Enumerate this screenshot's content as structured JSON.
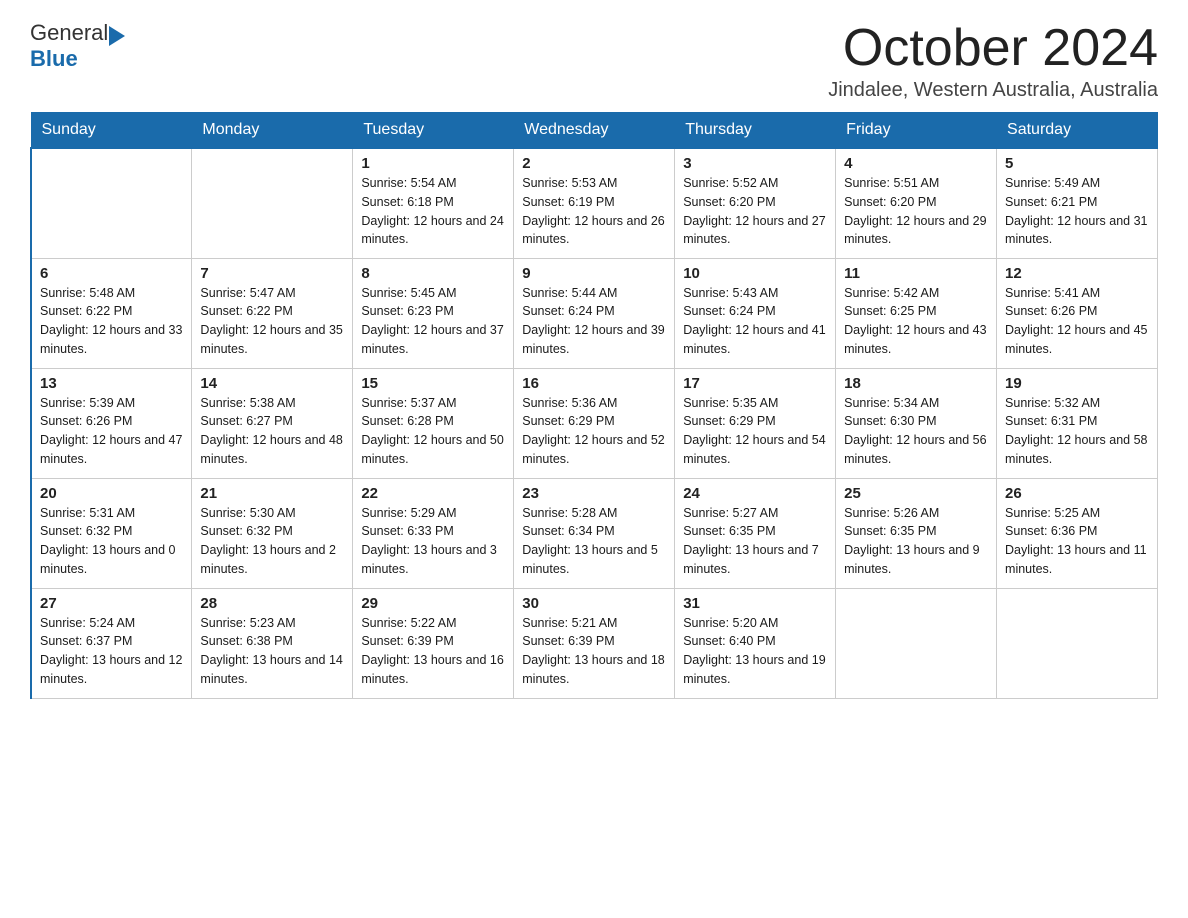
{
  "header": {
    "logo_line1": "General",
    "logo_line2": "Blue",
    "main_title": "October 2024",
    "subtitle": "Jindalee, Western Australia, Australia"
  },
  "weekdays": [
    "Sunday",
    "Monday",
    "Tuesday",
    "Wednesday",
    "Thursday",
    "Friday",
    "Saturday"
  ],
  "weeks": [
    [
      {
        "day": "",
        "sunrise": "",
        "sunset": "",
        "daylight": ""
      },
      {
        "day": "",
        "sunrise": "",
        "sunset": "",
        "daylight": ""
      },
      {
        "day": "1",
        "sunrise": "Sunrise: 5:54 AM",
        "sunset": "Sunset: 6:18 PM",
        "daylight": "Daylight: 12 hours and 24 minutes."
      },
      {
        "day": "2",
        "sunrise": "Sunrise: 5:53 AM",
        "sunset": "Sunset: 6:19 PM",
        "daylight": "Daylight: 12 hours and 26 minutes."
      },
      {
        "day": "3",
        "sunrise": "Sunrise: 5:52 AM",
        "sunset": "Sunset: 6:20 PM",
        "daylight": "Daylight: 12 hours and 27 minutes."
      },
      {
        "day": "4",
        "sunrise": "Sunrise: 5:51 AM",
        "sunset": "Sunset: 6:20 PM",
        "daylight": "Daylight: 12 hours and 29 minutes."
      },
      {
        "day": "5",
        "sunrise": "Sunrise: 5:49 AM",
        "sunset": "Sunset: 6:21 PM",
        "daylight": "Daylight: 12 hours and 31 minutes."
      }
    ],
    [
      {
        "day": "6",
        "sunrise": "Sunrise: 5:48 AM",
        "sunset": "Sunset: 6:22 PM",
        "daylight": "Daylight: 12 hours and 33 minutes."
      },
      {
        "day": "7",
        "sunrise": "Sunrise: 5:47 AM",
        "sunset": "Sunset: 6:22 PM",
        "daylight": "Daylight: 12 hours and 35 minutes."
      },
      {
        "day": "8",
        "sunrise": "Sunrise: 5:45 AM",
        "sunset": "Sunset: 6:23 PM",
        "daylight": "Daylight: 12 hours and 37 minutes."
      },
      {
        "day": "9",
        "sunrise": "Sunrise: 5:44 AM",
        "sunset": "Sunset: 6:24 PM",
        "daylight": "Daylight: 12 hours and 39 minutes."
      },
      {
        "day": "10",
        "sunrise": "Sunrise: 5:43 AM",
        "sunset": "Sunset: 6:24 PM",
        "daylight": "Daylight: 12 hours and 41 minutes."
      },
      {
        "day": "11",
        "sunrise": "Sunrise: 5:42 AM",
        "sunset": "Sunset: 6:25 PM",
        "daylight": "Daylight: 12 hours and 43 minutes."
      },
      {
        "day": "12",
        "sunrise": "Sunrise: 5:41 AM",
        "sunset": "Sunset: 6:26 PM",
        "daylight": "Daylight: 12 hours and 45 minutes."
      }
    ],
    [
      {
        "day": "13",
        "sunrise": "Sunrise: 5:39 AM",
        "sunset": "Sunset: 6:26 PM",
        "daylight": "Daylight: 12 hours and 47 minutes."
      },
      {
        "day": "14",
        "sunrise": "Sunrise: 5:38 AM",
        "sunset": "Sunset: 6:27 PM",
        "daylight": "Daylight: 12 hours and 48 minutes."
      },
      {
        "day": "15",
        "sunrise": "Sunrise: 5:37 AM",
        "sunset": "Sunset: 6:28 PM",
        "daylight": "Daylight: 12 hours and 50 minutes."
      },
      {
        "day": "16",
        "sunrise": "Sunrise: 5:36 AM",
        "sunset": "Sunset: 6:29 PM",
        "daylight": "Daylight: 12 hours and 52 minutes."
      },
      {
        "day": "17",
        "sunrise": "Sunrise: 5:35 AM",
        "sunset": "Sunset: 6:29 PM",
        "daylight": "Daylight: 12 hours and 54 minutes."
      },
      {
        "day": "18",
        "sunrise": "Sunrise: 5:34 AM",
        "sunset": "Sunset: 6:30 PM",
        "daylight": "Daylight: 12 hours and 56 minutes."
      },
      {
        "day": "19",
        "sunrise": "Sunrise: 5:32 AM",
        "sunset": "Sunset: 6:31 PM",
        "daylight": "Daylight: 12 hours and 58 minutes."
      }
    ],
    [
      {
        "day": "20",
        "sunrise": "Sunrise: 5:31 AM",
        "sunset": "Sunset: 6:32 PM",
        "daylight": "Daylight: 13 hours and 0 minutes."
      },
      {
        "day": "21",
        "sunrise": "Sunrise: 5:30 AM",
        "sunset": "Sunset: 6:32 PM",
        "daylight": "Daylight: 13 hours and 2 minutes."
      },
      {
        "day": "22",
        "sunrise": "Sunrise: 5:29 AM",
        "sunset": "Sunset: 6:33 PM",
        "daylight": "Daylight: 13 hours and 3 minutes."
      },
      {
        "day": "23",
        "sunrise": "Sunrise: 5:28 AM",
        "sunset": "Sunset: 6:34 PM",
        "daylight": "Daylight: 13 hours and 5 minutes."
      },
      {
        "day": "24",
        "sunrise": "Sunrise: 5:27 AM",
        "sunset": "Sunset: 6:35 PM",
        "daylight": "Daylight: 13 hours and 7 minutes."
      },
      {
        "day": "25",
        "sunrise": "Sunrise: 5:26 AM",
        "sunset": "Sunset: 6:35 PM",
        "daylight": "Daylight: 13 hours and 9 minutes."
      },
      {
        "day": "26",
        "sunrise": "Sunrise: 5:25 AM",
        "sunset": "Sunset: 6:36 PM",
        "daylight": "Daylight: 13 hours and 11 minutes."
      }
    ],
    [
      {
        "day": "27",
        "sunrise": "Sunrise: 5:24 AM",
        "sunset": "Sunset: 6:37 PM",
        "daylight": "Daylight: 13 hours and 12 minutes."
      },
      {
        "day": "28",
        "sunrise": "Sunrise: 5:23 AM",
        "sunset": "Sunset: 6:38 PM",
        "daylight": "Daylight: 13 hours and 14 minutes."
      },
      {
        "day": "29",
        "sunrise": "Sunrise: 5:22 AM",
        "sunset": "Sunset: 6:39 PM",
        "daylight": "Daylight: 13 hours and 16 minutes."
      },
      {
        "day": "30",
        "sunrise": "Sunrise: 5:21 AM",
        "sunset": "Sunset: 6:39 PM",
        "daylight": "Daylight: 13 hours and 18 minutes."
      },
      {
        "day": "31",
        "sunrise": "Sunrise: 5:20 AM",
        "sunset": "Sunset: 6:40 PM",
        "daylight": "Daylight: 13 hours and 19 minutes."
      },
      {
        "day": "",
        "sunrise": "",
        "sunset": "",
        "daylight": ""
      },
      {
        "day": "",
        "sunrise": "",
        "sunset": "",
        "daylight": ""
      }
    ]
  ]
}
